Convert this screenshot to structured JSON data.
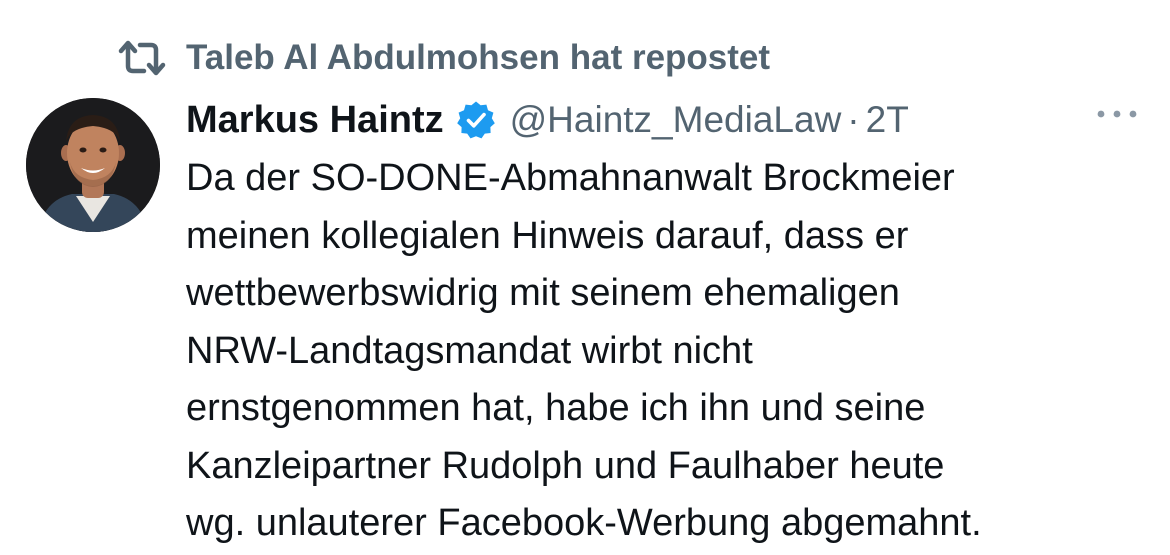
{
  "repost": {
    "icon": "repost-icon",
    "text": "Taleb Al Abdulmohsen hat repostet"
  },
  "tweet": {
    "author": {
      "display_name": "Markus Haintz",
      "verified_icon": "verified-badge-icon",
      "handle": "@Haintz_MediaLaw",
      "separator": "·",
      "timestamp": "2T"
    },
    "more_icon": "more-options-icon",
    "text_lines": [
      "Da der SO-DONE-Abmahnanwalt Brockmeier",
      "meinen kollegialen Hinweis darauf, dass er",
      "wettbewerbswidrig mit seinem ehemaligen",
      "NRW-Landtagsmandat wirbt nicht",
      "ernstgenommen hat, habe ich ihn und seine",
      "Kanzleipartner Rudolph und Faulhaber heute",
      "wg. unlauterer Facebook-Werbung abgemahnt."
    ]
  },
  "colors": {
    "text_primary": "#0f1419",
    "text_secondary": "#536471",
    "verified_blue": "#1d9bf0",
    "background": "#ffffff"
  }
}
